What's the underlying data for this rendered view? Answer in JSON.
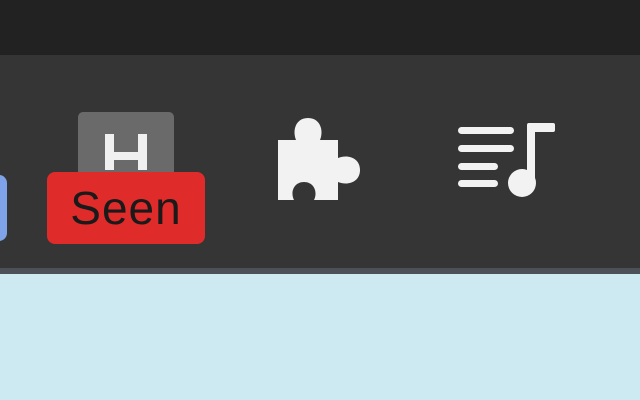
{
  "toolbar": {
    "extensions": [
      {
        "name": "h-extension",
        "icon": "h-letter-icon",
        "badge_text": "Seen",
        "badge_color": "#e02b2b"
      },
      {
        "name": "extensions-menu",
        "icon": "puzzle-piece-icon"
      },
      {
        "name": "media-playlist",
        "icon": "playlist-music-icon"
      }
    ]
  },
  "colors": {
    "toolbar_bg": "#353535",
    "top_strip_bg": "#222222",
    "content_bg": "#cdeaf3",
    "icon_color": "#f2f2f2"
  }
}
